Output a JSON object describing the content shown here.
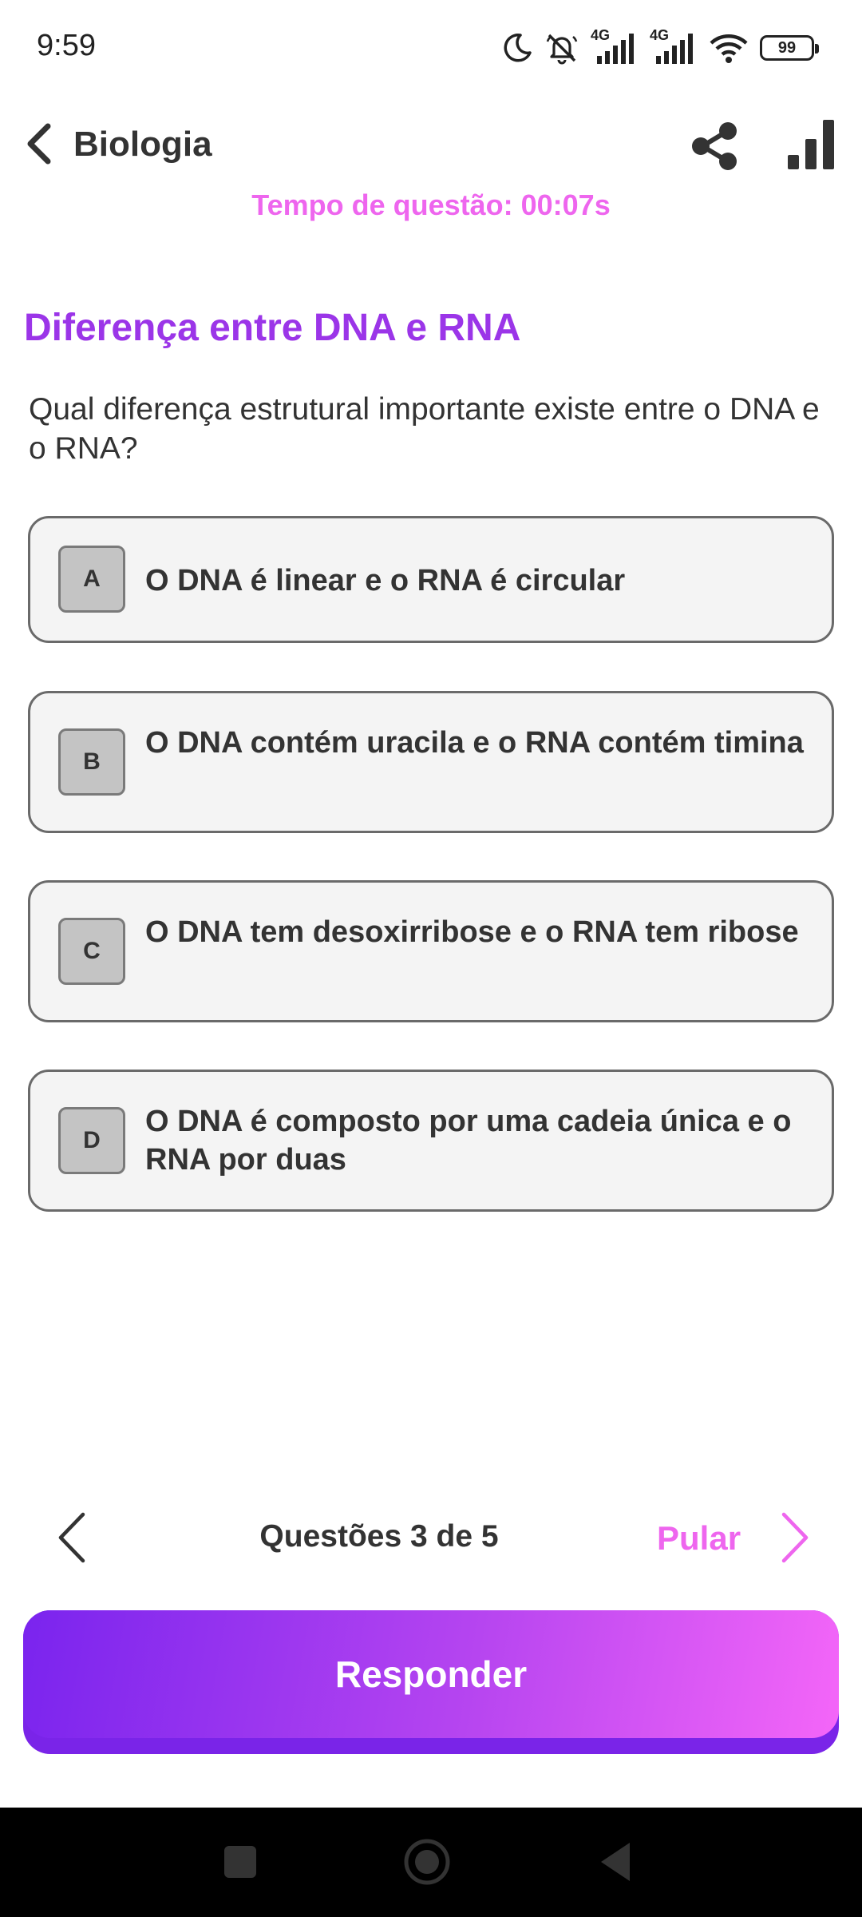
{
  "status_bar": {
    "time": "9:59",
    "network_1": "4G",
    "network_2": "4G",
    "battery": "99"
  },
  "header": {
    "title": "Biologia"
  },
  "timer": "Tempo de questão: 00:07s",
  "question": {
    "title": "Diferença entre DNA e RNA",
    "text": "Qual diferença estrutural importante existe entre o DNA e o RNA?"
  },
  "options": [
    {
      "letter": "A",
      "text": "O DNA é linear e o RNA é circular"
    },
    {
      "letter": "B",
      "text": "O DNA contém uracila e o RNA contém timina"
    },
    {
      "letter": "C",
      "text": "O DNA tem desoxirribose e o RNA tem ribose"
    },
    {
      "letter": "D",
      "text": "O DNA é composto por uma cadeia única e o RNA por duas"
    }
  ],
  "navigation": {
    "counter": "Questões 3 de 5",
    "skip_label": "Pular"
  },
  "answer_button": {
    "label": "Responder"
  },
  "colors": {
    "accent_purple": "#9b35e8",
    "accent_pink": "#ee66ee",
    "gradient_start": "#7a24ee",
    "gradient_end": "#f466f8"
  }
}
